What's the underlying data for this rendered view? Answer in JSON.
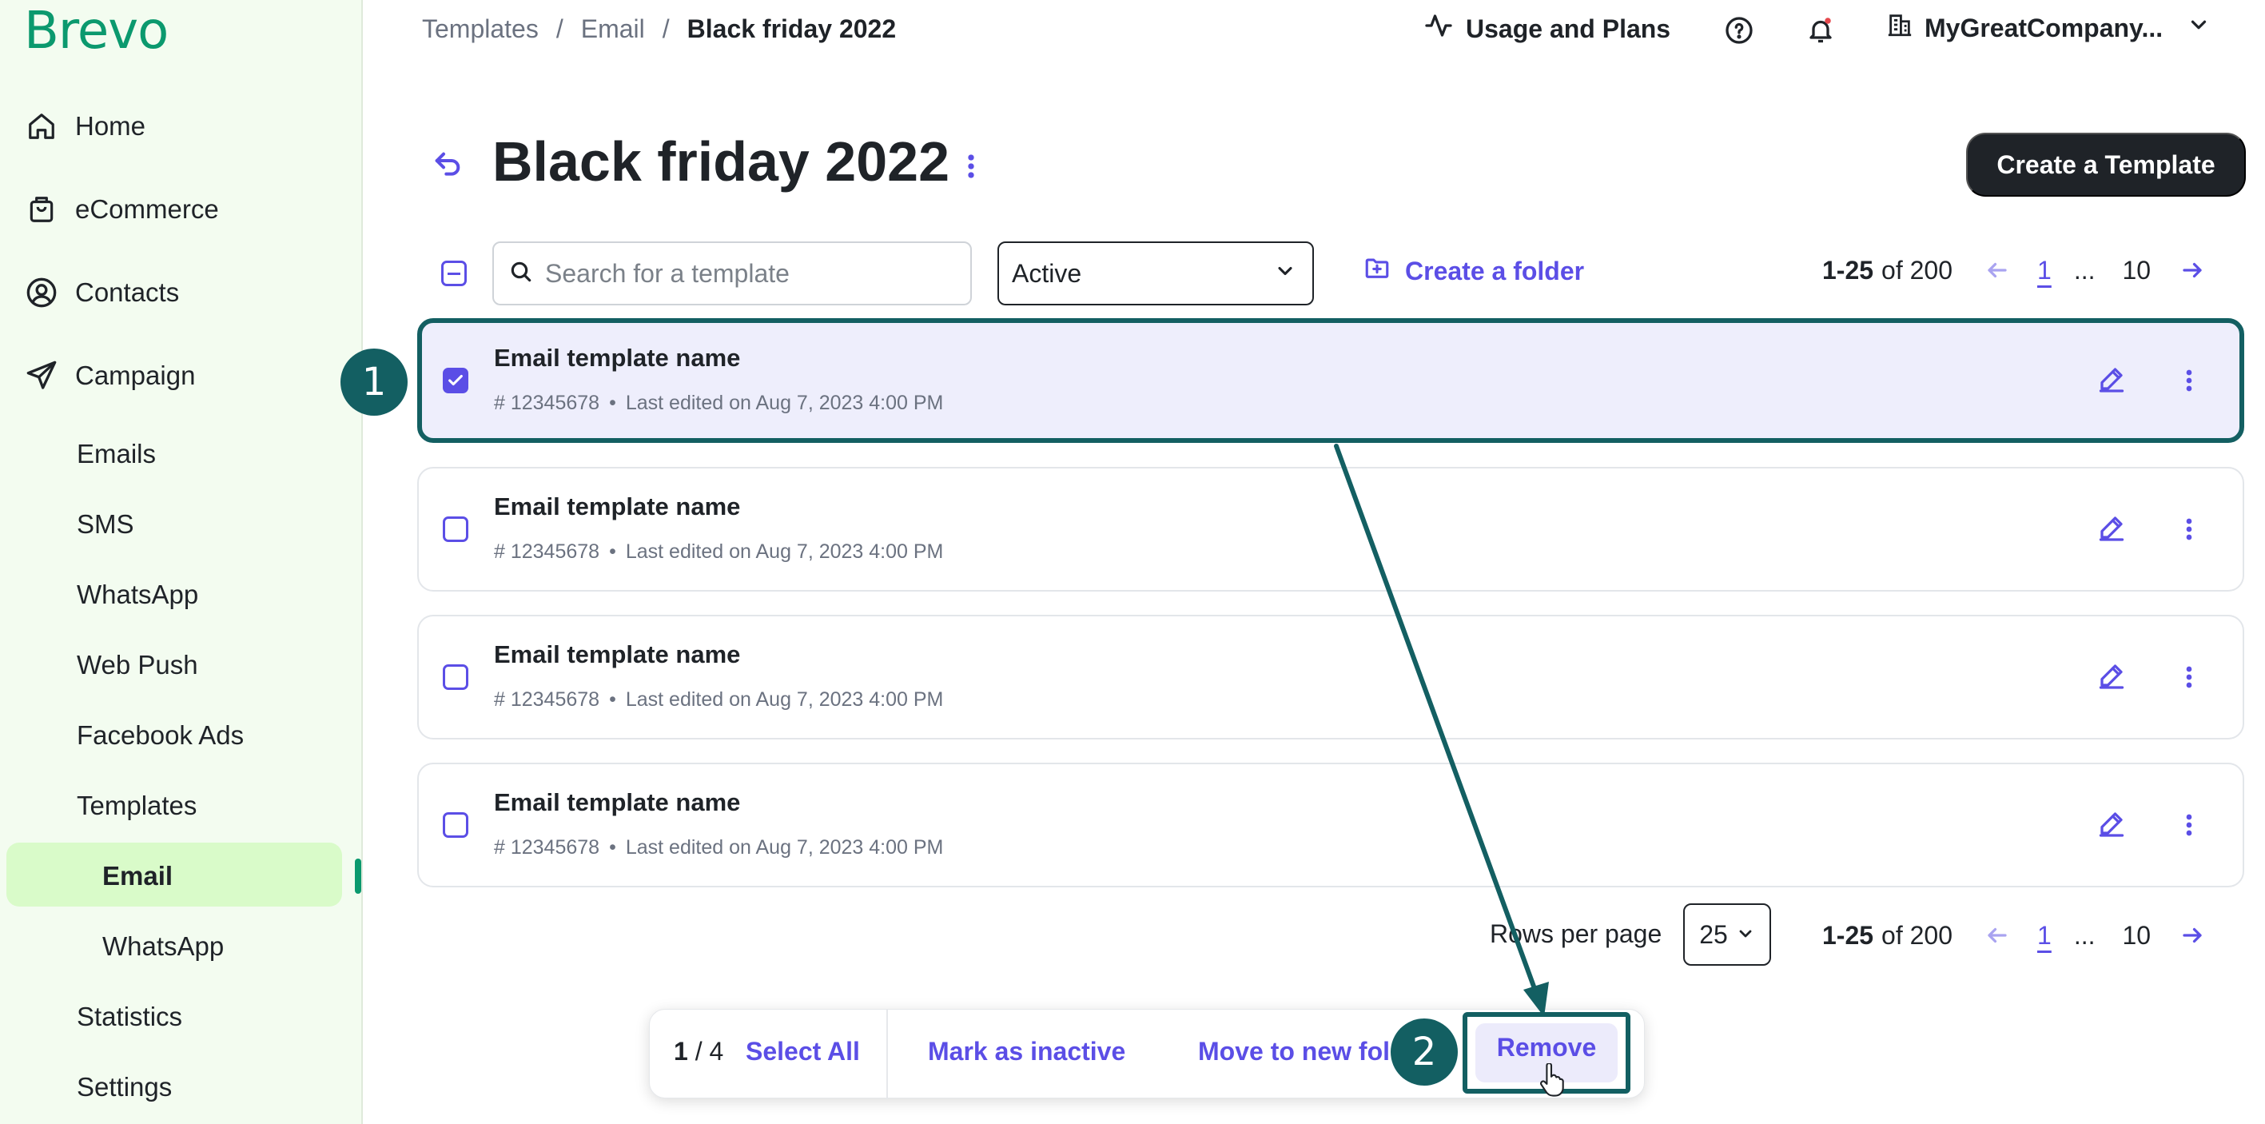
{
  "brand": {
    "logo": "Brevo",
    "accent": "#0b996e",
    "link_color": "#5b4ee6",
    "annotation_color": "#135f62"
  },
  "sidebar": {
    "items": [
      {
        "label": "Home",
        "icon": "home-icon"
      },
      {
        "label": "eCommerce",
        "icon": "shopping-bag-icon"
      },
      {
        "label": "Contacts",
        "icon": "user-circle-icon"
      },
      {
        "label": "Campaign",
        "icon": "send-icon"
      }
    ],
    "campaign_sub": [
      "Emails",
      "SMS",
      "WhatsApp",
      "Web Push",
      "Facebook Ads",
      "Templates"
    ],
    "templates_sub": [
      "Email",
      "WhatsApp"
    ],
    "bottom": [
      "Statistics",
      "Settings"
    ],
    "active": "Email"
  },
  "header": {
    "breadcrumb": [
      "Templates",
      "Email",
      "Black friday 2022"
    ],
    "separator": "/",
    "usage_label": "Usage and Plans",
    "company": "MyGreatCompany..."
  },
  "page": {
    "title": "Black friday 2022",
    "create_button": "Create a Template"
  },
  "toolbar": {
    "search_placeholder": "Search for a template",
    "status_value": "Active",
    "create_folder": "Create a folder"
  },
  "pagination": {
    "range": "1-25",
    "of_label": "of 200",
    "current_page": "1",
    "ellipsis": "...",
    "last_page": "10",
    "rows_per_page_label": "Rows per page",
    "rows_per_page_value": "25"
  },
  "rows": [
    {
      "name": "Email template name",
      "id": "# 12345678",
      "bullet": "•",
      "edited": "Last edited on Aug 7, 2023 4:00 PM",
      "selected": true
    },
    {
      "name": "Email template name",
      "id": "# 12345678",
      "bullet": "•",
      "edited": "Last edited on Aug 7, 2023 4:00 PM",
      "selected": false
    },
    {
      "name": "Email template name",
      "id": "# 12345678",
      "bullet": "•",
      "edited": "Last edited on Aug 7, 2023 4:00 PM",
      "selected": false
    },
    {
      "name": "Email template name",
      "id": "# 12345678",
      "bullet": "•",
      "edited": "Last edited on Aug 7, 2023 4:00 PM",
      "selected": false
    }
  ],
  "action_bar": {
    "selected_count": "1",
    "total": "/ 4",
    "select_all": "Select All",
    "mark_inactive": "Mark as inactive",
    "move_folder": "Move to new fol",
    "remove": "Remove"
  },
  "annotations": {
    "step1": "1",
    "step2": "2"
  }
}
